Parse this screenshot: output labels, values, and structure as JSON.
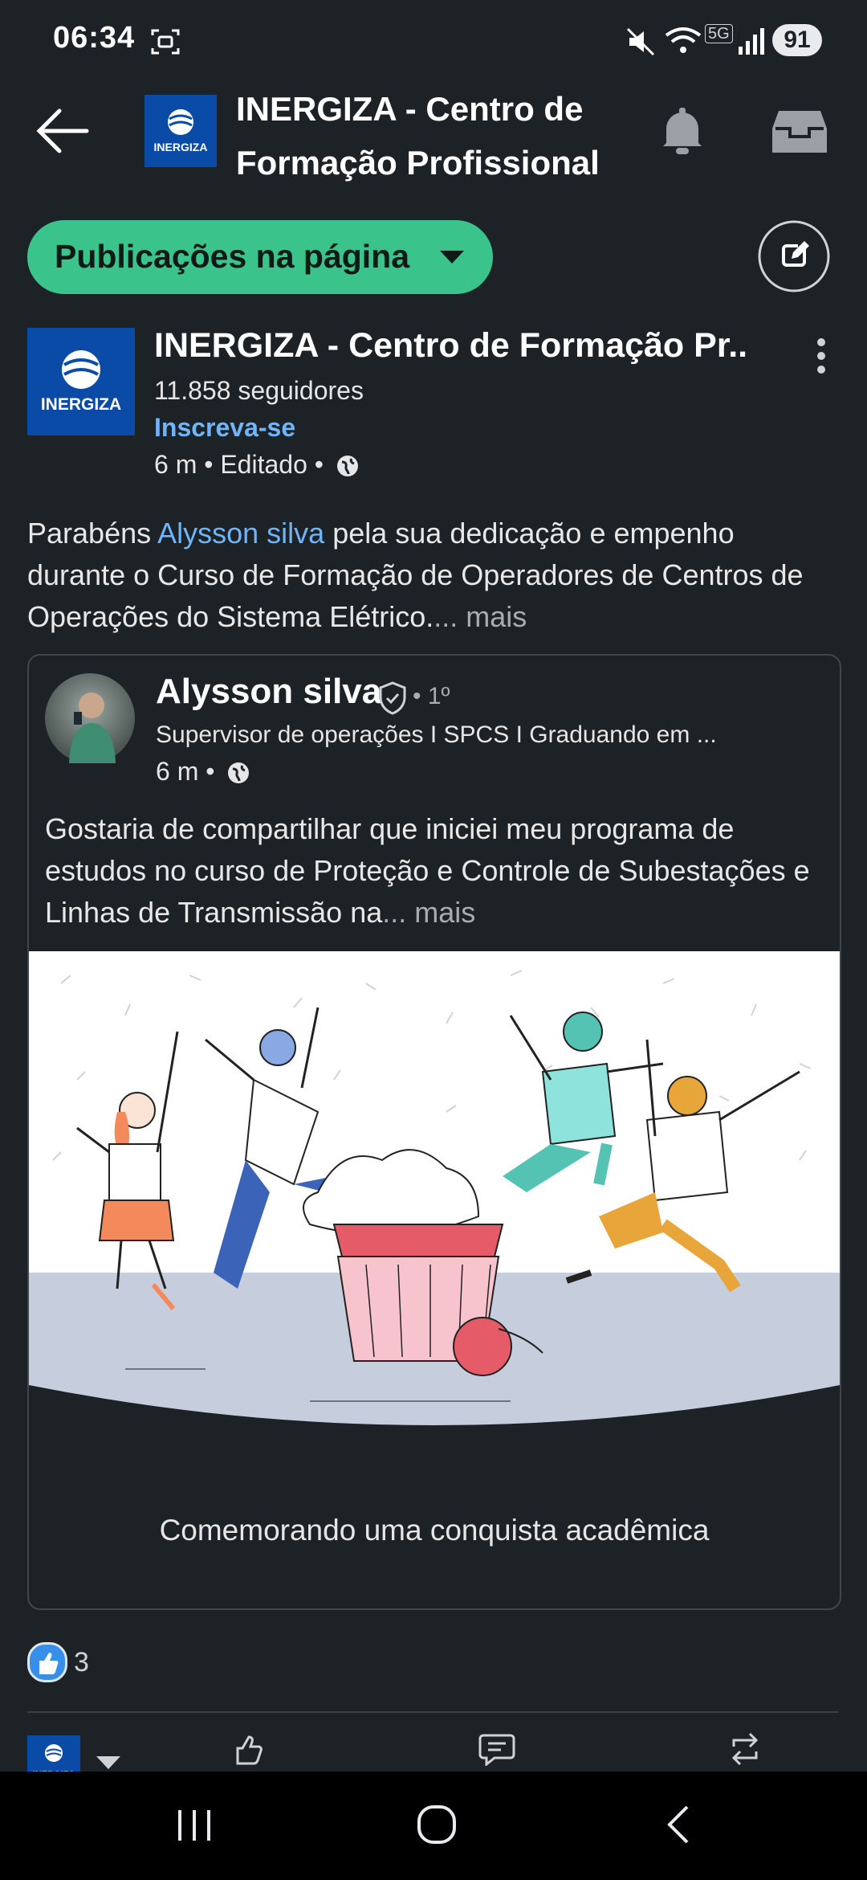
{
  "status_bar": {
    "time": "06:34",
    "battery": "91",
    "network": "5G"
  },
  "header": {
    "title": "INERGIZA - Centro de Formação Profissional",
    "logo_text": "INERGIZA"
  },
  "filter": {
    "label": "Publicações na página"
  },
  "post": {
    "author": "INERGIZA - Centro de Formação Pr...",
    "followers": "11.858 seguidores",
    "subscribe_label": "Inscreva-se",
    "meta": "6 m • Editado •",
    "body_prefix": "Parabéns ",
    "mention": "Alysson silva",
    "body_rest": " pela sua dedicação e empenho durante o Curso de Formação de Operadores de Centros de Operações do Sistema Elétrico.",
    "more": "... mais"
  },
  "shared": {
    "name": "Alysson silva",
    "degree": "• 1º",
    "headline": "Supervisor de operações I SPCS I Graduando em ...",
    "meta": "6 m •",
    "body": "Gostaria de compartilhar que iniciei meu programa de estudos no curso de Proteção e Controle de Subestações e Linhas de Transmissão na",
    "more": "... mais",
    "caption": "Comemorando uma conquista acadêmica"
  },
  "reactions": {
    "count": "3"
  },
  "colors": {
    "accent_green": "#3ac48c",
    "link_blue": "#70b5f9",
    "background": "#1d2226"
  }
}
